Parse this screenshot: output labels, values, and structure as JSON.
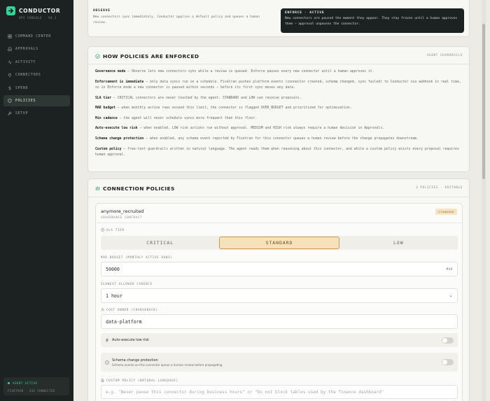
{
  "brand": {
    "title": "CONDUCTOR",
    "subtitle": "OPS CONSOLE · V0.1"
  },
  "nav": [
    {
      "label": "COMMAND CENTER",
      "icon": "grid-icon"
    },
    {
      "label": "APPROVALS",
      "icon": "inbox-icon"
    },
    {
      "label": "ACTIVITY",
      "icon": "pulse-icon"
    },
    {
      "label": "CONNECTORS",
      "icon": "plug-icon"
    },
    {
      "label": "SPEND",
      "icon": "dollar-icon"
    },
    {
      "label": "POLICIES",
      "icon": "shield-icon",
      "active": true
    },
    {
      "label": "SETUP",
      "icon": "wrench-icon"
    }
  ],
  "agent": {
    "status": "AGENT ACTIVE",
    "detail": "FIVETRAN · SSE CONNECTED"
  },
  "modes": {
    "observe": {
      "title": "OBSERVE",
      "text": "New connectors sync immediately. Conductor applies a default policy and queues a human review."
    },
    "enforce": {
      "title": "ENFORCE · ACTIVE",
      "text": "New connectors are paused the moment they appear. They stay frozen until a human approves them — approval unpauses the connector."
    }
  },
  "how": {
    "title": "HOW POLICIES ARE ENFORCED",
    "tag": "AGENT GUARDRAILS",
    "rules": [
      {
        "term": "Governance mode",
        "text": " — Observe lets new connectors sync while a review is queued. Enforce pauses every new connector until a human approves it."
      },
      {
        "term": "Enforcement is immediate",
        "text": " — only data syncs run on a schedule. Fivetran pushes platform events (connector created, schema changed, sync failed) to Conductor via webhook in real time, so in Enforce mode a new connector is paused within seconds — before its first sync moves any data."
      },
      {
        "term": "SLA tier",
        "text": " — CRITICAL connectors are never touched by the agent. STANDARD and LOW can receive proposals."
      },
      {
        "term": "MAR budget",
        "text": " — when monthly active rows exceed this limit, the connector is flagged OVER_BUDGET and prioritized for optimization."
      },
      {
        "term": "Min cadence",
        "text": " — the agent will never schedule syncs more frequent than this floor."
      },
      {
        "term": "Auto-execute low risk",
        "text": " — when enabled, LOW risk actions run without approval. MEDIUM and HIGH risk always require a human decision in Approvals."
      },
      {
        "term": "Schema change protection",
        "text": " — when enabled, any schema event reported by Fivetran for this connector queues a human review before the change propagates downstream."
      },
      {
        "term": "Custom policy",
        "text": " — free-text guardrails written in natural language. The agent reads them when reasoning about this connector, and while a custom policy exists every proposal requires human approval."
      }
    ]
  },
  "connections": {
    "title": "CONNECTION POLICIES",
    "count": "3 POLICIES · EDITABLE",
    "policy": {
      "name": "anymore_recruited",
      "subtitle": "GOVERNANCE CONTRACT",
      "badge": "STANDARD",
      "sla_label": "SLA TIER",
      "sla_options": [
        "CRITICAL",
        "STANDARD",
        "LOW"
      ],
      "sla_selected": "STANDARD",
      "mar_label": "MAR BUDGET (MONTHLY ACTIVE ROWS)",
      "mar_value": "50000",
      "mar_suffix": "MAR",
      "cadence_label": "SLOWEST ALLOWED CADENCE",
      "cadence_value": "1 hour",
      "owner_label": "COST OWNER (CHARGEBACK)",
      "owner_value": "data-platform",
      "auto_exec": {
        "title": "Auto-execute low risk",
        "enabled": false
      },
      "schema": {
        "title": "Schema change protection",
        "subtitle": "Schema events on this connector queue a human review before propagating",
        "enabled": false
      },
      "custom_label": "CUSTOM POLICY (NATURAL LANGUAGE)",
      "custom_placeholder": "e.g. \"Never pause this connector during business hours\" or \"Do not block tables used by the finance dashboard\""
    }
  },
  "colors": {
    "accent": "#34d399",
    "sidebar": "#1c2221",
    "standard_badge": "#f5e4c6"
  }
}
